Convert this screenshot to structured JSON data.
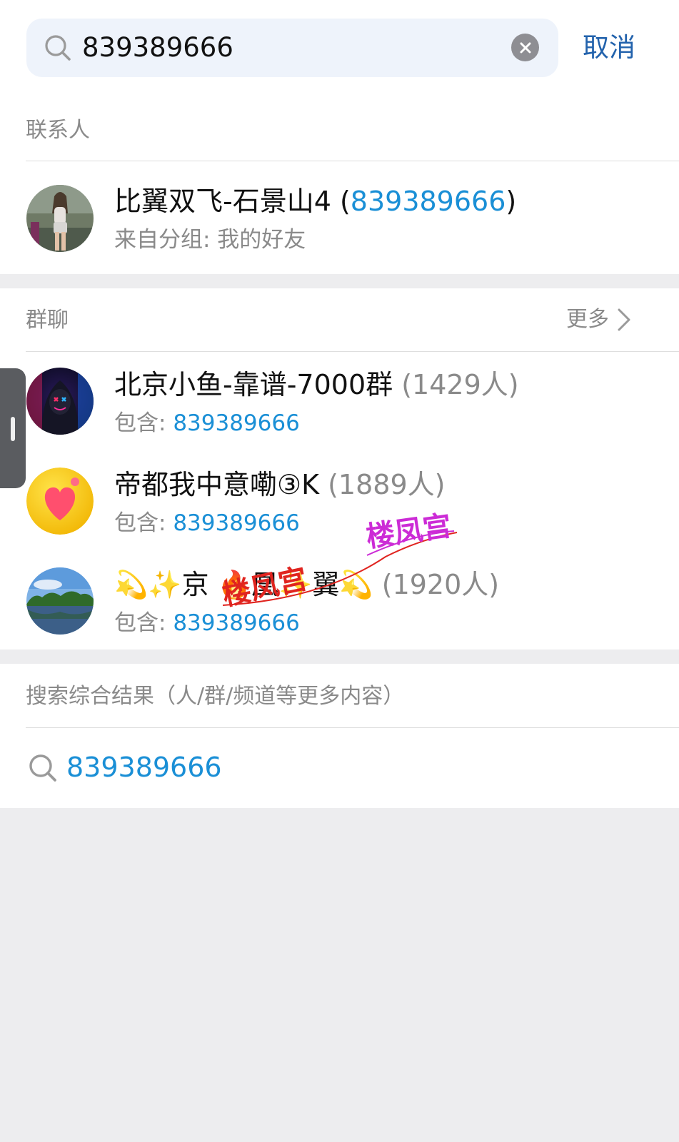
{
  "search": {
    "query": "839389666",
    "cancel_label": "取消"
  },
  "contacts": {
    "section_label": "联系人",
    "items": [
      {
        "name": "比翼双飞-石景山4 (",
        "id": "839389666",
        "close": ")",
        "subtitle": "来自分组: 我的好友"
      }
    ]
  },
  "groups": {
    "section_label": "群聊",
    "more_label": "更多",
    "items": [
      {
        "name": "北京小鱼-靠谱-7000群",
        "count": "(1429人)",
        "contains_label": "包含: ",
        "match": "839389666"
      },
      {
        "name": "帝都我中意嘞③K",
        "count": "(1889人)",
        "contains_label": "包含: ",
        "match": "839389666"
      },
      {
        "name_prefix": "💫✨京 🔥凰✨翼💫",
        "count": "(1920人)",
        "contains_label": "包含: ",
        "match": "839389666"
      }
    ]
  },
  "comprehensive": {
    "section_label": "搜索综合结果（人/群/频道等更多内容）",
    "query": "839389666"
  },
  "watermarks": [
    "楼凤宫",
    "楼凤宫"
  ],
  "colors": {
    "accent_blue": "#1a8fd6",
    "cancel_blue": "#2262ac",
    "background": "#ededef",
    "watermark_red": "#e0241f",
    "watermark_magenta": "#cc2bd6"
  }
}
